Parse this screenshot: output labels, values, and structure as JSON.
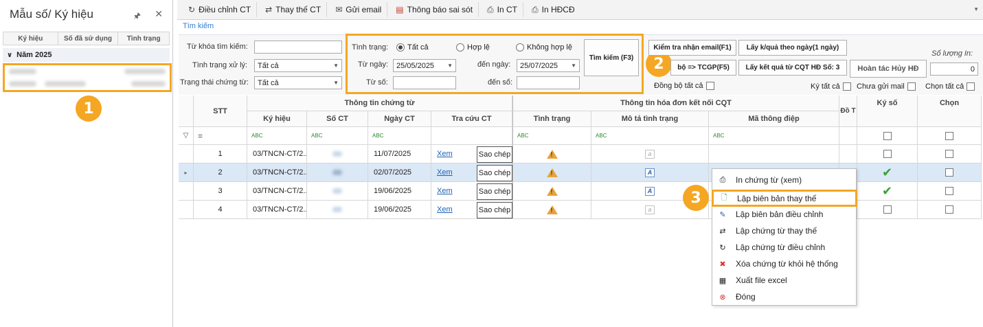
{
  "left_panel": {
    "title": "Mẫu số/ Ký hiệu",
    "pin_icon": "pin-icon",
    "close_icon": "close-icon",
    "columns": [
      "Ký hiệu",
      "Số đã sử dụng",
      "Tình trạng"
    ],
    "year_group": "Năm 2025"
  },
  "badges": {
    "b1": "1",
    "b2": "2",
    "b3": "3"
  },
  "toolbar": {
    "items": [
      {
        "label": "Điều chỉnh CT",
        "icon": "adjust-icon"
      },
      {
        "label": "Thay thế CT",
        "icon": "replace-icon"
      },
      {
        "label": "Gửi email",
        "icon": "email-icon"
      },
      {
        "label": "Thông báo sai sót",
        "icon": "report-icon"
      },
      {
        "label": "In CT",
        "icon": "print-icon"
      },
      {
        "label": "In HĐCĐ",
        "icon": "print-icon"
      }
    ]
  },
  "search": {
    "tab_label": "Tìm kiếm",
    "keyword_label": "Từ khóa tìm kiếm:",
    "keyword_value": "",
    "process_status_label": "Tình trạng xử lý:",
    "process_status_value": "Tất cả",
    "doc_status_label": "Trạng thái chứng từ:",
    "doc_status_value": "Tất cả",
    "status_label": "Tình trạng:",
    "radio_all": "Tất cả",
    "radio_valid": "Hợp lệ",
    "radio_invalid": "Không hợp lệ",
    "from_date_label": "Từ ngày:",
    "from_date": "25/05/2025",
    "to_date_label": "đến ngày:",
    "to_date": "25/07/2025",
    "from_no_label": "Từ số:",
    "to_no_label": "đến số:",
    "search_button": "Tìm kiếm (F3)",
    "check_email_button": "Kiểm tra nhận email(F1)",
    "get_result_day_button": "Lấy k/quả theo ngày(1 ngày)",
    "sync_button": "bộ => TCGP(F5)",
    "get_result_cqt_button": "Lấy kết quả từ CQT HĐ Số: 3",
    "undo_cancel_button": "Hoàn tác Hủy HĐ",
    "quantity_label": "Số lượng In:",
    "quantity_value": "0",
    "sync_all_label": "Đồng bộ tất cả",
    "sign_all_label": "Ký tất cả",
    "not_sent_mail_label": "Chưa gửi mail",
    "select_all_label": "Chọn tất cả"
  },
  "grid": {
    "header_stt": "STT",
    "group_doc_info": "Thông tin chứng từ",
    "group_invoice_info": "Thông tin hóa đơn kết nối CQT",
    "col_symbol": "Ký hiệu",
    "col_doc_no": "Số CT",
    "col_doc_date": "Ngày CT",
    "col_lookup": "Tra cứu CT",
    "col_status": "Tình trạng",
    "col_status_desc": "Mô tả tình trạng",
    "col_message_code": "Mã thông điệp",
    "col_sync_trunc": "Đồ T",
    "col_sign": "Ký số",
    "col_select": "Chọn",
    "filter_eq": "=",
    "filter_abc": "ABC",
    "view_link": "Xem",
    "copy_button": "Sao chép",
    "rows": [
      {
        "stt": "1",
        "symbol": "03/TNCN-CT/2...",
        "date": "11/07/2025",
        "desc_icon": "faded",
        "signed": false
      },
      {
        "stt": "2",
        "symbol": "03/TNCN-CT/2...",
        "date": "02/07/2025",
        "desc_icon": "active",
        "signed": true
      },
      {
        "stt": "3",
        "symbol": "03/TNCN-CT/2...",
        "date": "19/06/2025",
        "desc_icon": "active",
        "signed": true
      },
      {
        "stt": "4",
        "symbol": "03/TNCN-CT/2...",
        "date": "19/06/2025",
        "desc_icon": "faded",
        "signed": false
      }
    ]
  },
  "context_menu": {
    "items": [
      {
        "label": "In chứng từ (xem)",
        "icon": "print-icon"
      },
      {
        "label": "Lập biên bản thay thế",
        "icon": "new-doc-icon"
      },
      {
        "label": "Lập biên bản điều chỉnh",
        "icon": "edit-icon"
      },
      {
        "label": "Lập chứng từ thay thế",
        "icon": "replace-icon"
      },
      {
        "label": "Lập chứng từ điều chỉnh",
        "icon": "adjust-icon"
      },
      {
        "label": "Xóa chứng từ khỏi hệ thống",
        "icon": "delete-icon"
      },
      {
        "label": "Xuất file excel",
        "icon": "excel-icon"
      },
      {
        "label": "Đóng",
        "icon": "close-circle-icon"
      }
    ]
  },
  "colors": {
    "highlight": "#f5a623",
    "selected_row": "#dbe8f6",
    "link": "#1a5fb4"
  }
}
